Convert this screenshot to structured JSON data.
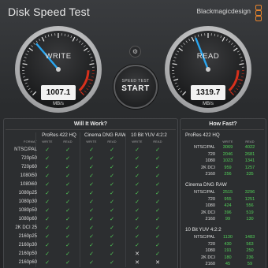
{
  "app": {
    "title": "Disk Speed Test",
    "brand": "Blackmagicdesign"
  },
  "gauges": {
    "write": {
      "label": "WRITE",
      "value": "1007.1",
      "unit": "MB/s",
      "needle_fraction": 0.35
    },
    "read": {
      "label": "READ",
      "value": "1319.7",
      "unit": "MB/s",
      "needle_fraction": 0.42
    }
  },
  "start_button": {
    "sub_label": "SPEED TEST",
    "label": "START"
  },
  "settings_icon": "gear-icon",
  "colors": {
    "accent_needle": "#2aa6f0",
    "check": "#52d158",
    "redline": "#d8301c"
  },
  "will_it_work": {
    "title": "Will It Work?",
    "format_header": "FORMAT",
    "codecs": [
      "ProRes 422 HQ",
      "Cinema DNG RAW",
      "10 Bit YUV 4:2:2"
    ],
    "sub_headers": [
      "WRITE",
      "READ"
    ],
    "rows": [
      {
        "name": "NTSC/PAL",
        "cells": [
          "✓",
          "✓",
          "✓",
          "✓",
          "✓",
          "✓"
        ]
      },
      {
        "name": "720p50",
        "cells": [
          "✓",
          "✓",
          "✓",
          "✓",
          "✓",
          "✓"
        ]
      },
      {
        "name": "720p60",
        "cells": [
          "✓",
          "✓",
          "✓",
          "✓",
          "✓",
          "✓"
        ]
      },
      {
        "name": "1080i50",
        "cells": [
          "✓",
          "✓",
          "✓",
          "✓",
          "✓",
          "✓"
        ]
      },
      {
        "name": "1080i60",
        "cells": [
          "✓",
          "✓",
          "✓",
          "✓",
          "✓",
          "✓"
        ]
      },
      {
        "name": "1080p25",
        "cells": [
          "✓",
          "✓",
          "✓",
          "✓",
          "✓",
          "✓"
        ]
      },
      {
        "name": "1080p30",
        "cells": [
          "✓",
          "✓",
          "✓",
          "✓",
          "✓",
          "✓"
        ]
      },
      {
        "name": "1080p50",
        "cells": [
          "✓",
          "✓",
          "✓",
          "✓",
          "✓",
          "✓"
        ]
      },
      {
        "name": "1080p60",
        "cells": [
          "✓",
          "✓",
          "✓",
          "✓",
          "✓",
          "✓"
        ]
      },
      {
        "name": "2K DCI 25",
        "cells": [
          "✓",
          "✓",
          "✓",
          "✓",
          "✓",
          "✓"
        ]
      },
      {
        "name": "2160p25",
        "cells": [
          "✓",
          "✓",
          "✓",
          "✓",
          "✓",
          "✓"
        ]
      },
      {
        "name": "2160p30",
        "cells": [
          "✓",
          "✓",
          "✓",
          "✓",
          "✓",
          "✓"
        ]
      },
      {
        "name": "2160p50",
        "cells": [
          "✓",
          "✓",
          "✓",
          "✓",
          "✕",
          "✓"
        ]
      },
      {
        "name": "2160p60",
        "cells": [
          "✓",
          "✓",
          "✓",
          "✓",
          "✕",
          "✕"
        ]
      }
    ]
  },
  "how_fast": {
    "title": "How Fast?",
    "sub_headers": [
      "WRITE",
      "READ"
    ],
    "sections": [
      {
        "name": "ProRes 422 HQ",
        "rows": [
          {
            "name": "NTSC/PAL",
            "write": "3069",
            "read": "4022"
          },
          {
            "name": "720",
            "write": "2046",
            "read": "2681"
          },
          {
            "name": "1080",
            "write": "1023",
            "read": "1341"
          },
          {
            "name": "2K DCI",
            "write": "959",
            "read": "1257"
          },
          {
            "name": "2160",
            "write": "256",
            "read": "335"
          }
        ]
      },
      {
        "name": "Cinema DNG RAW",
        "rows": [
          {
            "name": "NTSC/PAL",
            "write": "2515",
            "read": "3296"
          },
          {
            "name": "720",
            "write": "955",
            "read": "1251"
          },
          {
            "name": "1080",
            "write": "424",
            "read": "556"
          },
          {
            "name": "2K DCI",
            "write": "396",
            "read": "519"
          },
          {
            "name": "2160",
            "write": "99",
            "read": "130"
          }
        ]
      },
      {
        "name": "10 Bit YUV 4:2:2",
        "rows": [
          {
            "name": "NTSC/PAL",
            "write": "1130",
            "read": "1483"
          },
          {
            "name": "720",
            "write": "430",
            "read": "563"
          },
          {
            "name": "1080",
            "write": "191",
            "read": "250"
          },
          {
            "name": "2K DCI",
            "write": "180",
            "read": "236"
          },
          {
            "name": "2160",
            "write": "45",
            "read": "59"
          }
        ]
      }
    ]
  }
}
